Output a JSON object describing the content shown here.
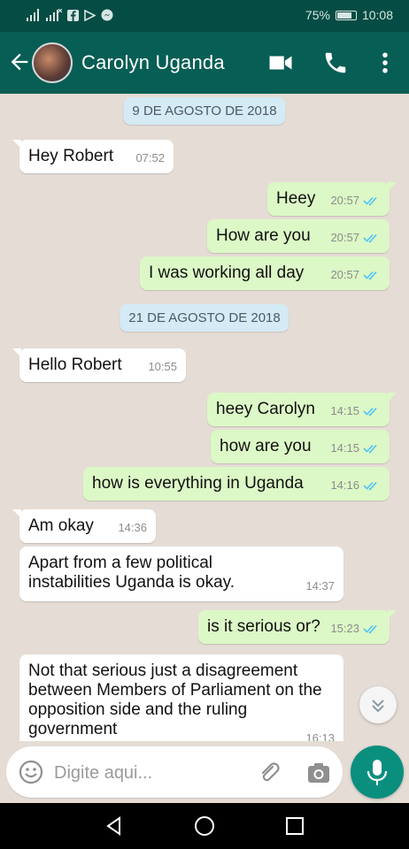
{
  "status_bar": {
    "left_icons": [
      "signal-icon",
      "signal-x-icon",
      "facebook-icon",
      "play-icon",
      "messenger-icon"
    ],
    "battery_text": "75%",
    "battery_level": 0.75,
    "time": "10:08"
  },
  "header": {
    "contact_name": "Carolyn Uganda",
    "icons": [
      "back-arrow-icon",
      "video-call-icon",
      "phone-icon",
      "more-vert-icon"
    ]
  },
  "chat": {
    "dates": [
      "9 DE AGOSTO DE 2018",
      "21 DE AGOSTO DE 2018"
    ],
    "messages": [
      {
        "dir": "in",
        "text": "Hey Robert",
        "time": "07:52"
      },
      {
        "dir": "out",
        "text": "Heey",
        "time": "20:57"
      },
      {
        "dir": "out",
        "text": "How are you",
        "time": "20:57"
      },
      {
        "dir": "out",
        "text": "I was working all day",
        "time": "20:57"
      },
      {
        "dir": "in",
        "text": "Hello Robert",
        "time": "10:55"
      },
      {
        "dir": "out",
        "text": "heey Carolyn",
        "time": "14:15"
      },
      {
        "dir": "out",
        "text": "how are you",
        "time": "14:15"
      },
      {
        "dir": "out",
        "text": "how is everything in Uganda",
        "time": "14:16"
      },
      {
        "dir": "in",
        "text": "Am okay",
        "time": "14:36"
      },
      {
        "dir": "in",
        "text": "Apart from a few political instabilities Uganda is okay.",
        "time": "14:37"
      },
      {
        "dir": "out",
        "text": "is it serious or?",
        "time": "15:23"
      },
      {
        "dir": "in",
        "text": "Not that serious just a disagreement between Members of Parliament on the opposition side and the ruling government",
        "time": "16:13"
      }
    ]
  },
  "input": {
    "placeholder": "Digite aqui...",
    "value": ""
  },
  "colors": {
    "header": "#075e54",
    "status_bar": "#054d44",
    "outgoing_bubble": "#dcf8c6",
    "incoming_bubble": "#ffffff",
    "chat_background": "#e5ddd5",
    "date_chip": "#d4eaf4",
    "read_tick": "#4fc3f7",
    "mic_button": "#0a8f7f"
  }
}
